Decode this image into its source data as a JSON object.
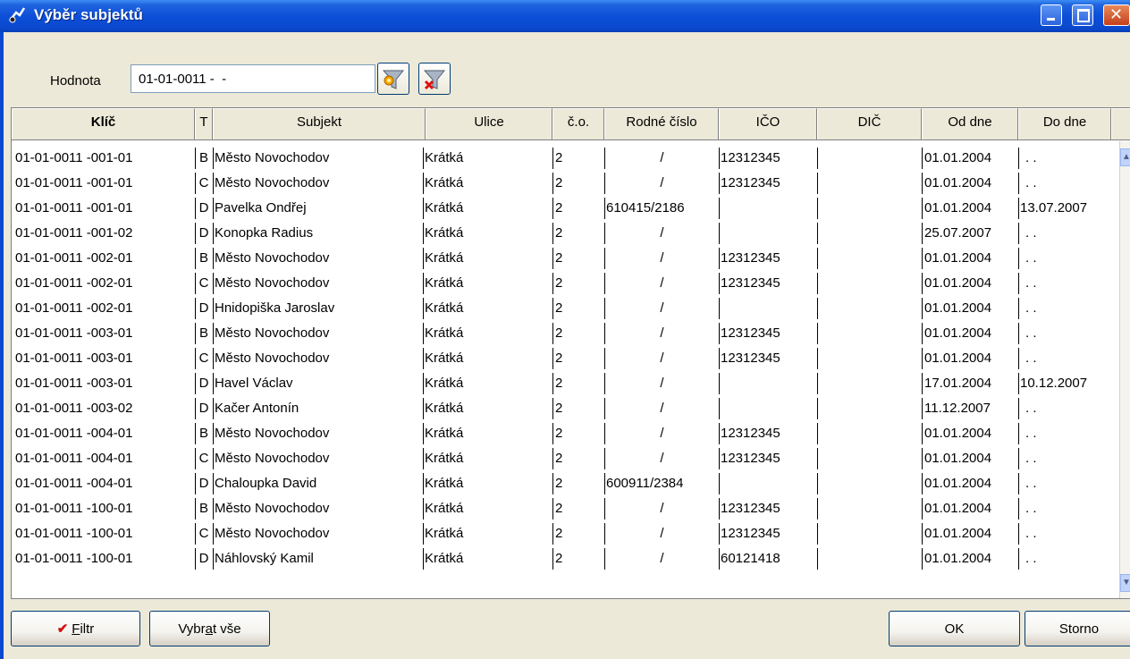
{
  "window": {
    "title": "Výběr subjektů"
  },
  "filter": {
    "label": "Hodnota",
    "value": "01-01-0011 -  -"
  },
  "columns": [
    "Klíč",
    "T",
    "Subjekt",
    "Ulice",
    "č.o.",
    "Rodné číslo",
    "IČO",
    "DIČ",
    "Od dne",
    "Do dne"
  ],
  "rows": [
    [
      "01-01-0011 -001-01",
      "B",
      "Město Novochodov",
      "Krátká",
      "2",
      "/",
      "12312345",
      "",
      "01.01.2004",
      ". ."
    ],
    [
      "01-01-0011 -001-01",
      "C",
      "Město Novochodov",
      "Krátká",
      "2",
      "/",
      "12312345",
      "",
      "01.01.2004",
      ". ."
    ],
    [
      "01-01-0011 -001-01",
      "D",
      "Pavelka Ondřej",
      "Krátká",
      "2",
      "610415/2186",
      "",
      "",
      "01.01.2004",
      "13.07.2007"
    ],
    [
      "01-01-0011 -001-02",
      "D",
      "Konopka Radius",
      "Krátká",
      "2",
      "/",
      "",
      "",
      "25.07.2007",
      ". ."
    ],
    [
      "01-01-0011 -002-01",
      "B",
      "Město Novochodov",
      "Krátká",
      "2",
      "/",
      "12312345",
      "",
      "01.01.2004",
      ". ."
    ],
    [
      "01-01-0011 -002-01",
      "C",
      "Město Novochodov",
      "Krátká",
      "2",
      "/",
      "12312345",
      "",
      "01.01.2004",
      ". ."
    ],
    [
      "01-01-0011 -002-01",
      "D",
      "Hnidopiška Jaroslav",
      "Krátká",
      "2",
      "/",
      "",
      "",
      "01.01.2004",
      ". ."
    ],
    [
      "01-01-0011 -003-01",
      "B",
      "Město Novochodov",
      "Krátká",
      "2",
      "/",
      "12312345",
      "",
      "01.01.2004",
      ". ."
    ],
    [
      "01-01-0011 -003-01",
      "C",
      "Město Novochodov",
      "Krátká",
      "2",
      "/",
      "12312345",
      "",
      "01.01.2004",
      ". ."
    ],
    [
      "01-01-0011 -003-01",
      "D",
      "Havel Václav",
      "Krátká",
      "2",
      "/",
      "",
      "",
      "17.01.2004",
      "10.12.2007"
    ],
    [
      "01-01-0011 -003-02",
      "D",
      "Kačer Antonín",
      "Krátká",
      "2",
      "/",
      "",
      "",
      "11.12.2007",
      ". ."
    ],
    [
      "01-01-0011 -004-01",
      "B",
      "Město Novochodov",
      "Krátká",
      "2",
      "/",
      "12312345",
      "",
      "01.01.2004",
      ". ."
    ],
    [
      "01-01-0011 -004-01",
      "C",
      "Město Novochodov",
      "Krátká",
      "2",
      "/",
      "12312345",
      "",
      "01.01.2004",
      ". ."
    ],
    [
      "01-01-0011 -004-01",
      "D",
      "Chaloupka David",
      "Krátká",
      "2",
      "600911/2384",
      "",
      "",
      "01.01.2004",
      ". ."
    ],
    [
      "01-01-0011 -100-01",
      "B",
      "Město Novochodov",
      "Krátká",
      "2",
      "/",
      "12312345",
      "",
      "01.01.2004",
      ". ."
    ],
    [
      "01-01-0011 -100-01",
      "C",
      "Město Novochodov",
      "Krátká",
      "2",
      "/",
      "12312345",
      "",
      "01.01.2004",
      ". ."
    ],
    [
      "01-01-0011 -100-01",
      "D",
      "Náhlovský Kamil",
      "Krátká",
      "2",
      "/",
      "60121418",
      "",
      "01.01.2004",
      ". ."
    ]
  ],
  "buttons": {
    "filter": {
      "pre": "",
      "ul": "F",
      "post": "iltr"
    },
    "select_all": {
      "pre": "Vybr",
      "ul": "a",
      "post": "t vše"
    },
    "ok": "OK",
    "cancel": "Storno"
  },
  "colors": {
    "titlebar": "#0a49cf",
    "face": "#ece9d8",
    "check": "#d01010"
  },
  "icons": {
    "title": "app-icon",
    "funnel_a": "filter-apply-icon",
    "funnel_b": "filter-clear-icon",
    "check": "checkmark-icon"
  }
}
